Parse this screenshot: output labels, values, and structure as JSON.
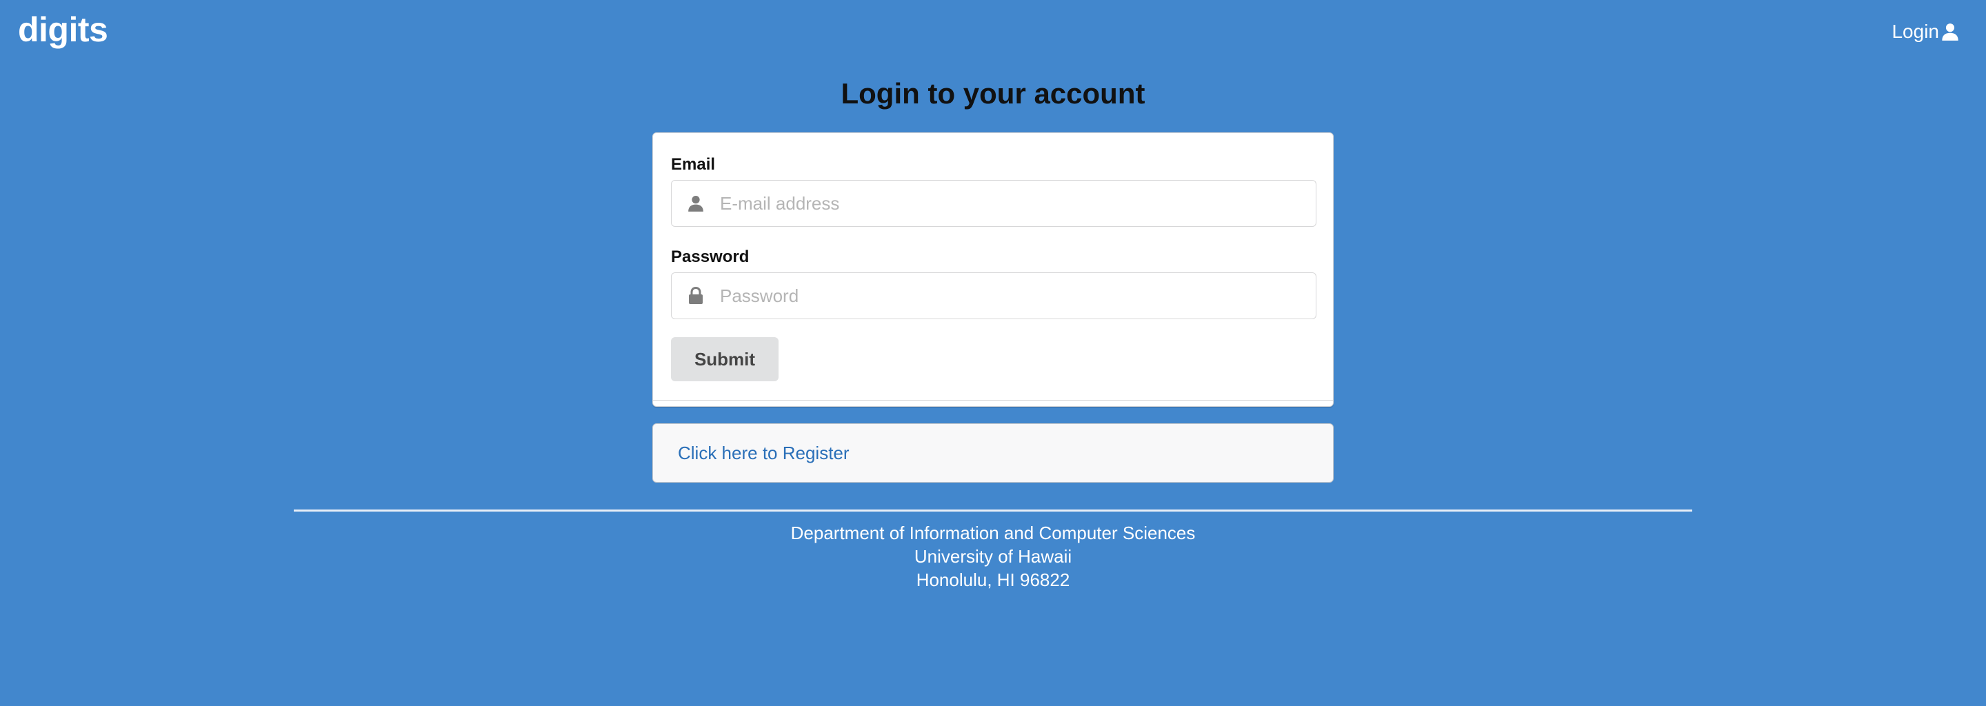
{
  "navbar": {
    "brand": "digits",
    "login_label": "Login"
  },
  "page": {
    "title": "Login to your account"
  },
  "form": {
    "email_label": "Email",
    "email_placeholder": "E-mail address",
    "email_value": "",
    "password_label": "Password",
    "password_placeholder": "Password",
    "password_value": "",
    "submit_label": "Submit"
  },
  "register": {
    "link_text": "Click here to Register"
  },
  "footer": {
    "line1": "Department of Information and Computer Sciences",
    "line2": "University of Hawaii",
    "line3": "Honolulu, HI 96822"
  },
  "icons": {
    "nav_login": "user-icon",
    "email": "user-icon",
    "password": "lock-icon"
  },
  "colors": {
    "background": "#4287cd",
    "card": "#ffffff",
    "register_box": "#f8f8f9",
    "link": "#2a6fb8",
    "button": "#e0e1e2"
  }
}
